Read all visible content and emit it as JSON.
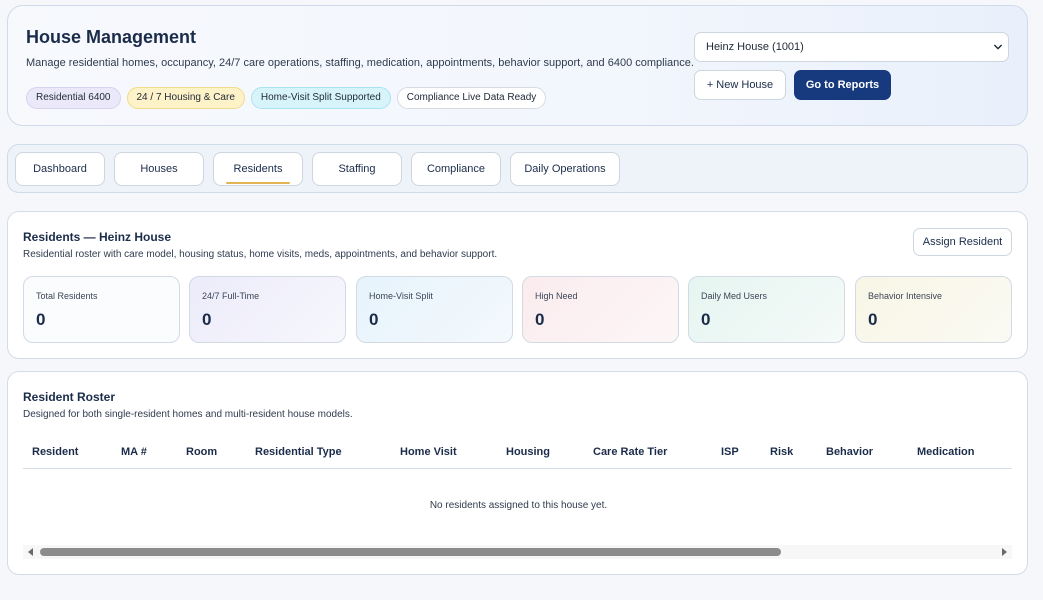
{
  "header": {
    "title": "House Management",
    "description": "Manage residential homes, occupancy, 24/7 care operations, staffing, medication, appointments, behavior support, and 6400 compliance.",
    "chips": [
      "Residential 6400",
      "24 / 7 Housing & Care",
      "Home-Visit Split Supported",
      "Compliance Live Data Ready"
    ],
    "house_select": {
      "value": "Heinz House (1001)"
    },
    "new_house_label": "+ New House",
    "reports_label": "Go to Reports"
  },
  "tabs": [
    {
      "label": "Dashboard",
      "active": false
    },
    {
      "label": "Houses",
      "active": false
    },
    {
      "label": "Residents",
      "active": true
    },
    {
      "label": "Staffing",
      "active": false
    },
    {
      "label": "Compliance",
      "active": false
    },
    {
      "label": "Daily Operations",
      "active": false
    }
  ],
  "residents": {
    "title": "Residents — Heinz House",
    "description": "Residential roster with care model, housing status, home visits, meds, appointments, and behavior support.",
    "assign_label": "Assign Resident",
    "stats": [
      {
        "label": "Total Residents",
        "value": "0"
      },
      {
        "label": "24/7 Full-Time",
        "value": "0"
      },
      {
        "label": "Home-Visit Split",
        "value": "0"
      },
      {
        "label": "High Need",
        "value": "0"
      },
      {
        "label": "Daily Med Users",
        "value": "0"
      },
      {
        "label": "Behavior Intensive",
        "value": "0"
      }
    ]
  },
  "roster": {
    "title": "Resident Roster",
    "description": "Designed for both single-resident homes and multi-resident house models.",
    "columns": [
      "Resident",
      "MA #",
      "Room",
      "Residential Type",
      "Home Visit",
      "Housing",
      "Care Rate Tier",
      "ISP",
      "Risk",
      "Behavior",
      "Medication"
    ],
    "empty_message": "No residents assigned to this house yet."
  },
  "colors": {
    "primary": "#163a7d",
    "active_tab_underline": "#e3b456"
  }
}
